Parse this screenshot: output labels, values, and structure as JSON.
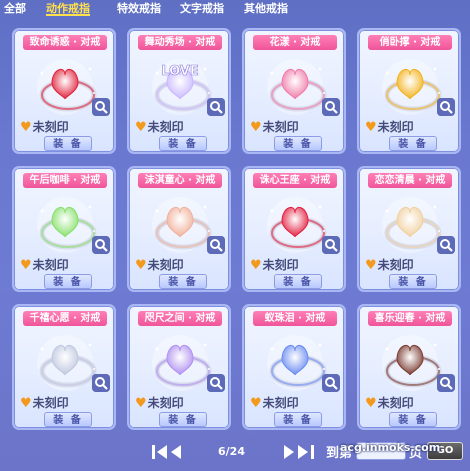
{
  "tabs": [
    "全部",
    "动作戒指",
    "特效戒指",
    "文字戒指",
    "其他戒指"
  ],
  "active_tab": "动作戒指",
  "rings": [
    {
      "name": "致命诱惑 · 对戒",
      "status": "未刻印",
      "button": "装 备",
      "color": "#e0213a"
    },
    {
      "name": "舞动秀场 · 对戒",
      "status": "未刻印",
      "button": "装 备",
      "color": "#c9b8ff",
      "ring_text": "LOVE"
    },
    {
      "name": "花漾 · 对戒",
      "status": "未刻印",
      "button": "装 备",
      "color": "#f07aa8"
    },
    {
      "name": "俏卧撑 · 对戒",
      "status": "未刻印",
      "button": "装 备",
      "color": "#f2b21c"
    },
    {
      "name": "午后咖啡 · 对戒",
      "status": "未刻印",
      "button": "装 备",
      "color": "#86e06a"
    },
    {
      "name": "沫淇童心 · 对戒",
      "status": "未刻印",
      "button": "装 备",
      "color": "#f0b09a"
    },
    {
      "name": "诛心王座 · 对戒",
      "status": "未刻印",
      "button": "装 备",
      "color": "#e22040"
    },
    {
      "name": "恋恋清晨 · 对戒",
      "status": "未刻印",
      "button": "装 备",
      "color": "#f0d0a0"
    },
    {
      "name": "千禧心愿 · 对戒",
      "status": "未刻印",
      "button": "装 备",
      "color": "#c0c8e0"
    },
    {
      "name": "咫尺之间 · 对戒",
      "status": "未刻印",
      "button": "装 备",
      "color": "#b090f0"
    },
    {
      "name": "蚁珠泪 · 对戒",
      "status": "未刻印",
      "button": "装 备",
      "color": "#6a8cf0"
    },
    {
      "name": "喜乐迎春 · 对戒",
      "status": "未刻印",
      "button": "装 备",
      "color": "#7a3a30"
    }
  ],
  "pager": {
    "first": "⏮",
    "prev": "◀",
    "next": "▶",
    "last": "⏭",
    "page_text": "6/24",
    "goto_label": "到第",
    "page_suffix": "页",
    "go_label": "GO",
    "input_value": ""
  },
  "watermark": "acg.inmoks.com"
}
